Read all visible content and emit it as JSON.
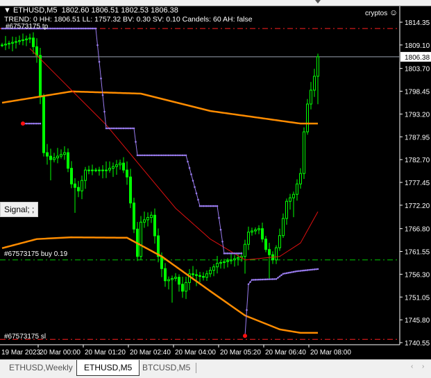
{
  "header": {
    "symbol": "ETHUSD,M5",
    "ohlc": "1802.60 1806.51 1802.53 1806.38",
    "info": "TREND: 0 HH: 1806.51 LL: 1757.32 BV: 0.30 SV: 0.10 Candels: 60 AH: false",
    "brand": "cryptos"
  },
  "labels": {
    "tp": "#67573175 tp",
    "buy": "#67573175 buy 0.19",
    "sl": "#67573175 sl",
    "signal": "Signal; ;"
  },
  "colors": {
    "candle": "#00ff00",
    "ma_slow": "#ff8c00",
    "ma_fast": "#e01010",
    "trail": "#9a7cf0",
    "tp_sl": "#ff2020",
    "buy": "#00cc00"
  },
  "tabs": [
    {
      "label": "ETHUSD,Weekly",
      "active": false
    },
    {
      "label": "ETHUSD,M5",
      "active": true
    },
    {
      "label": "BTCUSD,M5",
      "active": false
    }
  ],
  "chart_data": {
    "type": "candlestick",
    "symbol": "ETHUSD",
    "timeframe": "M5",
    "ylim": [
      1739.5,
      1815.5
    ],
    "yticks": [
      "1814.35",
      "1809.10",
      "1803.70",
      "1798.45",
      "1793.20",
      "1787.95",
      "1782.70",
      "1777.45",
      "1772.20",
      "1766.80",
      "1761.55",
      "1756.30",
      "1751.05",
      "1745.80",
      "1740.55"
    ],
    "current_price": "1806.38",
    "xticks": [
      "19 Mar 2023",
      "20 Mar 00:00",
      "20 Mar 01:20",
      "20 Mar 02:40",
      "20 Mar 04:00",
      "20 Mar 05:20",
      "20 Mar 06:40",
      "20 Mar 08:00"
    ],
    "bars": 92,
    "close_keypoints": [
      [
        0,
        1809.1
      ],
      [
        8,
        1810.7
      ],
      [
        10,
        1806.7
      ],
      [
        11,
        1797.1
      ],
      [
        12,
        1784.3
      ],
      [
        14,
        1782.7
      ],
      [
        18,
        1784.3
      ],
      [
        20,
        1777.1
      ],
      [
        22,
        1775.5
      ],
      [
        24,
        1780.3
      ],
      [
        30,
        1780.3
      ],
      [
        34,
        1781.9
      ],
      [
        36,
        1778.7
      ],
      [
        38,
        1766.7
      ],
      [
        39,
        1760.4
      ],
      [
        40,
        1768.3
      ],
      [
        43,
        1769.9
      ],
      [
        45,
        1760.4
      ],
      [
        47,
        1754.8
      ],
      [
        50,
        1755.6
      ],
      [
        52,
        1752.4
      ],
      [
        54,
        1756.4
      ],
      [
        58,
        1755.6
      ],
      [
        62,
        1758.8
      ],
      [
        66,
        1759.6
      ],
      [
        69,
        1760.4
      ],
      [
        71,
        1766.0
      ],
      [
        74,
        1766.8
      ],
      [
        76,
        1762.0
      ],
      [
        78,
        1759.6
      ],
      [
        80,
        1765.2
      ],
      [
        82,
        1773.1
      ],
      [
        84,
        1774.7
      ],
      [
        86,
        1779.5
      ],
      [
        87,
        1789.1
      ],
      [
        88,
        1795.5
      ],
      [
        90,
        1801.9
      ],
      [
        91,
        1806.38
      ]
    ],
    "ma_slow": [
      [
        0,
        1795.8
      ],
      [
        20,
        1798.4
      ],
      [
        40,
        1797.9
      ],
      [
        60,
        1793.9
      ],
      [
        86,
        1791.0
      ],
      [
        91,
        1791.0
      ]
    ],
    "ma_lower": [
      [
        0,
        1762.3
      ],
      [
        10,
        1764.4
      ],
      [
        20,
        1764.8
      ],
      [
        36,
        1764.7
      ],
      [
        46,
        1760.4
      ],
      [
        60,
        1752.4
      ],
      [
        70,
        1746.8
      ],
      [
        80,
        1743.6
      ],
      [
        86,
        1742.8
      ],
      [
        91,
        1742.8
      ]
    ],
    "ma_fast": [
      [
        8,
        1808.3
      ],
      [
        20,
        1798.7
      ],
      [
        30,
        1790.7
      ],
      [
        40,
        1781.1
      ],
      [
        50,
        1771.5
      ],
      [
        60,
        1764.4
      ],
      [
        70,
        1759.6
      ],
      [
        80,
        1760.4
      ],
      [
        86,
        1763.5
      ],
      [
        91,
        1770.7
      ]
    ],
    "trail_a": [
      [
        0,
        1812.9
      ],
      [
        27,
        1812.9
      ],
      [
        30,
        1789.9
      ],
      [
        38,
        1789.9
      ],
      [
        39,
        1783.7
      ],
      [
        53,
        1783.7
      ],
      [
        57,
        1772.0
      ],
      [
        62,
        1772.0
      ],
      [
        64,
        1761.1
      ],
      [
        69,
        1761.1
      ]
    ],
    "trail_b": [
      [
        6,
        1791.0
      ],
      [
        11,
        1791.0
      ]
    ],
    "trail_c": [
      [
        70,
        1742.1
      ],
      [
        71,
        1754.0
      ],
      [
        72,
        1755.0
      ],
      [
        79,
        1755.2
      ],
      [
        81,
        1756.4
      ],
      [
        85,
        1757.0
      ],
      [
        91,
        1757.5
      ]
    ],
    "dots": [
      [
        6,
        1791.0
      ],
      [
        70,
        1742.1
      ]
    ],
    "tp": 1812.9,
    "buy": 1759.6,
    "sl": 1741.3
  }
}
